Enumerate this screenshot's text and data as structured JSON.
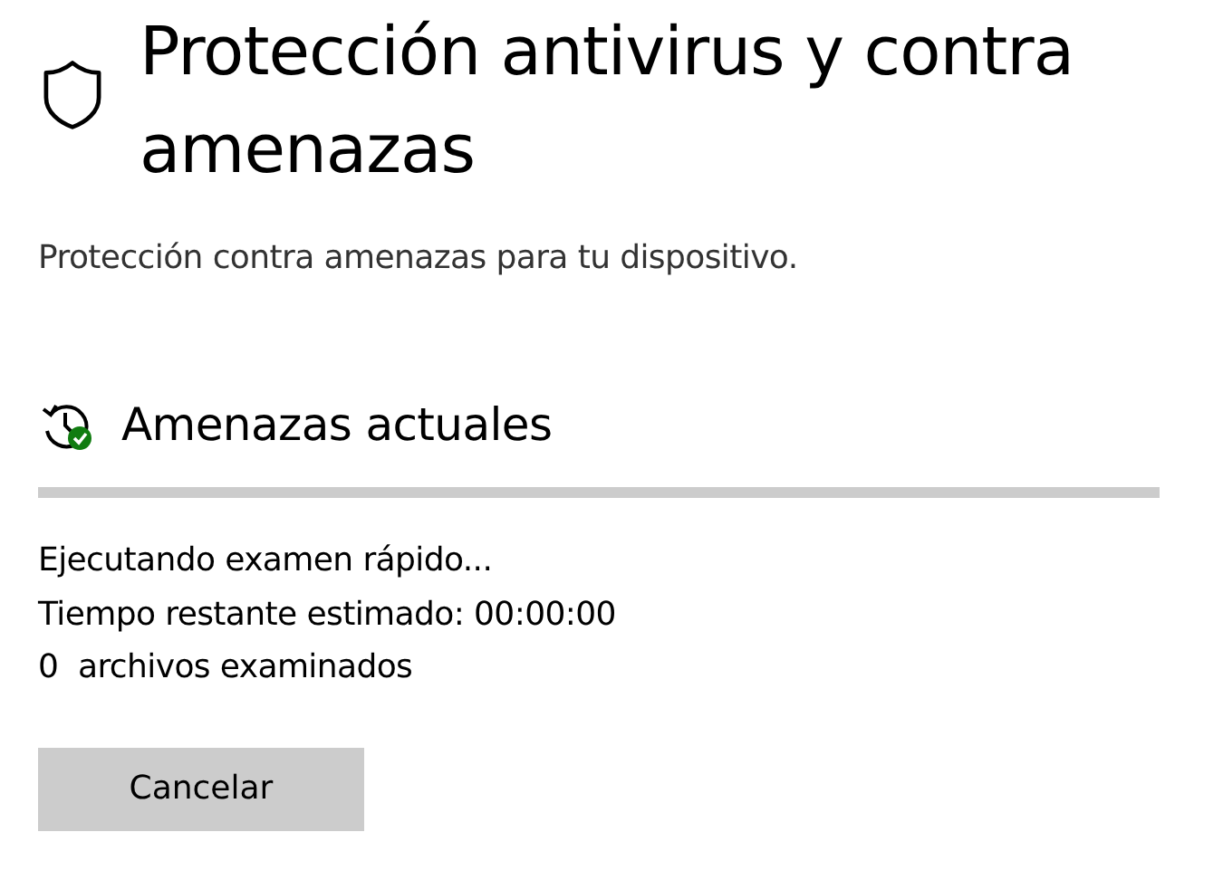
{
  "page": {
    "title": "Protección antivirus y contra amenazas",
    "subtitle": "Protección contra amenazas para tu dispositivo."
  },
  "section": {
    "title": "Amenazas actuales"
  },
  "scan": {
    "lines": [
      "Ejecutando examen rápido...",
      "Tiempo restante estimado: 00:00:00",
      "0  archivos examinados"
    ]
  },
  "button": {
    "label": "Cancelar"
  }
}
